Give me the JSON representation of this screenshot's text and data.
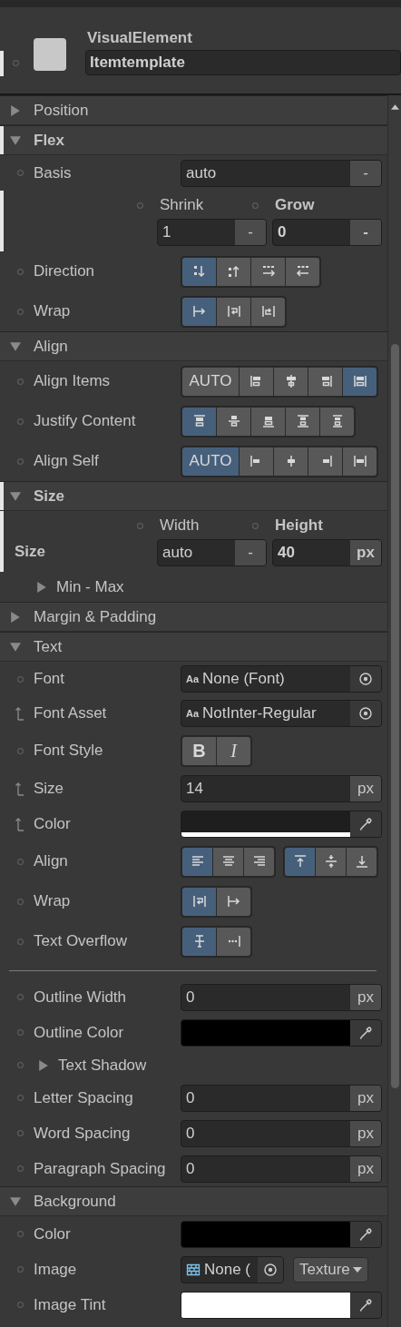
{
  "header": {
    "type_label": "VisualElement",
    "name": "Itemtemplate",
    "overridden": true
  },
  "sections": [
    {
      "title": "Position",
      "expanded": false,
      "overridden": false
    },
    {
      "title": "Flex",
      "expanded": true,
      "overridden": true,
      "rows": [
        {
          "kind": "field",
          "inherited": false,
          "label": "Basis",
          "value": "auto",
          "unit": "-",
          "overridden": false
        },
        {
          "kind": "pair",
          "overridden": true,
          "fields": [
            {
              "label": "Shrink",
              "value": "1",
              "unit": "-",
              "overridden": false
            },
            {
              "label": "Grow",
              "value": "0",
              "unit": "-",
              "overridden": true
            }
          ]
        },
        {
          "kind": "buttons",
          "inherited": false,
          "label": "Direction",
          "overridden": false,
          "groups": [
            [
              {
                "kind": "col",
                "selected": true
              },
              {
                "kind": "colrev",
                "selected": false
              },
              {
                "kind": "row",
                "selected": false
              },
              {
                "kind": "rowrev",
                "selected": false
              }
            ]
          ]
        },
        {
          "kind": "buttons",
          "inherited": false,
          "label": "Wrap",
          "overridden": false,
          "groups": [
            [
              {
                "kind": "nowrap",
                "selected": true
              },
              {
                "kind": "wrap",
                "selected": false
              },
              {
                "kind": "wraprev",
                "selected": false
              }
            ]
          ]
        }
      ]
    },
    {
      "title": "Align",
      "expanded": true,
      "overridden": false,
      "rows": [
        {
          "kind": "buttons",
          "inherited": false,
          "label": "Align Items",
          "overridden": false,
          "groups": [
            [
              {
                "kind": "text",
                "label": "AUTO",
                "selected": false
              },
              {
                "kind": "ai-start",
                "selected": false
              },
              {
                "kind": "ai-center",
                "selected": false
              },
              {
                "kind": "ai-end",
                "selected": false
              },
              {
                "kind": "ai-stretch",
                "selected": true
              }
            ]
          ]
        },
        {
          "kind": "buttons",
          "inherited": false,
          "label": "Justify Content",
          "overridden": false,
          "groups": [
            [
              {
                "kind": "jc-start",
                "selected": true
              },
              {
                "kind": "jc-center",
                "selected": false
              },
              {
                "kind": "jc-end",
                "selected": false
              },
              {
                "kind": "jc-between",
                "selected": false
              },
              {
                "kind": "jc-around",
                "selected": false
              }
            ]
          ]
        },
        {
          "kind": "buttons",
          "inherited": false,
          "label": "Align Self",
          "overridden": false,
          "groups": [
            [
              {
                "kind": "text",
                "label": "AUTO",
                "selected": true
              },
              {
                "kind": "as-start",
                "selected": false
              },
              {
                "kind": "as-center",
                "selected": false
              },
              {
                "kind": "as-end",
                "selected": false
              },
              {
                "kind": "as-stretch",
                "selected": false
              }
            ]
          ]
        }
      ]
    },
    {
      "title": "Size",
      "expanded": true,
      "overridden": true,
      "rows": [
        {
          "kind": "pair",
          "label": "Size",
          "overridden": true,
          "fields": [
            {
              "label": "Width",
              "value": "auto",
              "unit": "-",
              "overridden": false
            },
            {
              "label": "Height",
              "value": "40",
              "unit": "px",
              "overridden": true
            }
          ]
        },
        {
          "kind": "foldout",
          "label": "Min - Max",
          "expanded": false,
          "overridden": false
        }
      ]
    },
    {
      "title": "Margin & Padding",
      "expanded": false,
      "overridden": false
    },
    {
      "title": "Text",
      "expanded": true,
      "overridden": false,
      "rows": [
        {
          "kind": "object",
          "inherited": false,
          "label": "Font",
          "prefix": "Aa",
          "value": "None (Font)",
          "overridden": false
        },
        {
          "kind": "object",
          "inherited": true,
          "label": "Font Asset",
          "prefix": "Aa",
          "value": "NotInter-Regular",
          "overridden": false
        },
        {
          "kind": "buttons",
          "inherited": false,
          "label": "Font Style",
          "overridden": false,
          "groups": [
            [
              {
                "kind": "bold",
                "label": "B",
                "selected": false
              },
              {
                "kind": "italic",
                "label": "I",
                "selected": false
              }
            ]
          ]
        },
        {
          "kind": "field",
          "inherited": true,
          "label": "Size",
          "value": "14",
          "unit": "px",
          "overridden": false
        },
        {
          "kind": "color",
          "inherited": true,
          "label": "Color",
          "color": "#1e1e1e",
          "level": 1,
          "overridden": false
        },
        {
          "kind": "buttons",
          "inherited": false,
          "label": "Align",
          "overridden": false,
          "groups": [
            [
              {
                "kind": "ta-left",
                "selected": true
              },
              {
                "kind": "ta-center",
                "selected": false
              },
              {
                "kind": "ta-right",
                "selected": false
              }
            ],
            [
              {
                "kind": "va-top",
                "selected": true
              },
              {
                "kind": "va-middle",
                "selected": false
              },
              {
                "kind": "va-bottom",
                "selected": false
              }
            ]
          ]
        },
        {
          "kind": "buttons",
          "inherited": false,
          "label": "Wrap",
          "overridden": false,
          "groups": [
            [
              {
                "kind": "wrap",
                "selected": true
              },
              {
                "kind": "nowrap",
                "selected": false
              }
            ]
          ]
        },
        {
          "kind": "buttons",
          "inherited": false,
          "label": "Text Overflow",
          "overridden": false,
          "groups": [
            [
              {
                "kind": "clip",
                "selected": true
              },
              {
                "kind": "ellipsis",
                "selected": false
              }
            ]
          ]
        },
        {
          "kind": "divider"
        },
        {
          "kind": "field",
          "inherited": false,
          "label": "Outline Width",
          "value": "0",
          "unit": "px",
          "overridden": false
        },
        {
          "kind": "color",
          "inherited": false,
          "label": "Outline Color",
          "color": "#000000",
          "level": 0,
          "overridden": false
        },
        {
          "kind": "foldout",
          "inherited": false,
          "label": "Text Shadow",
          "expanded": false,
          "overridden": false
        },
        {
          "kind": "field",
          "inherited": false,
          "label": "Letter Spacing",
          "value": "0",
          "unit": "px",
          "overridden": false
        },
        {
          "kind": "field",
          "inherited": false,
          "label": "Word Spacing",
          "value": "0",
          "unit": "px",
          "overridden": false
        },
        {
          "kind": "field",
          "inherited": false,
          "label": "Paragraph Spacing",
          "value": "0",
          "unit": "px",
          "overridden": false
        }
      ]
    },
    {
      "title": "Background",
      "expanded": true,
      "overridden": false,
      "rows": [
        {
          "kind": "color",
          "inherited": false,
          "label": "Color",
          "color": "#000000",
          "level": 0,
          "overridden": false
        },
        {
          "kind": "image",
          "inherited": false,
          "label": "Image",
          "value": "None (",
          "dropdown": "Texture",
          "overridden": false
        },
        {
          "kind": "color",
          "inherited": false,
          "label": "Image Tint",
          "color": "#ffffff",
          "level": 1,
          "overridden": false
        }
      ]
    }
  ]
}
